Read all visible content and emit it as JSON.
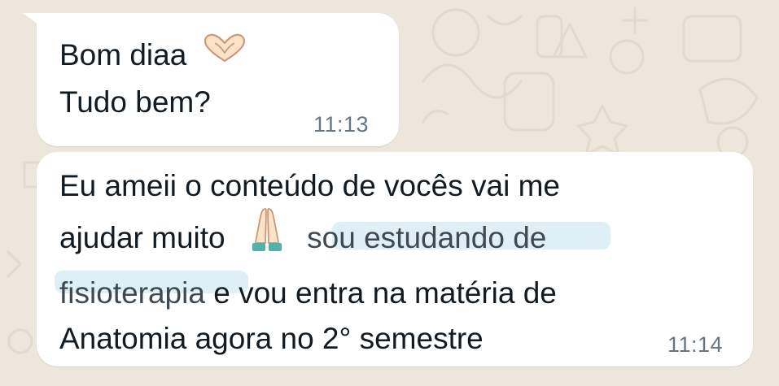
{
  "messages": [
    {
      "lines": [
        "Bom diaa",
        "Tudo bem?"
      ],
      "emoji": "heart-hands",
      "time": "11:13"
    },
    {
      "line1": "Eu ameii o conteúdo de vocês vai me",
      "line2_a": "ajudar muito",
      "line2_link": "sou estudando de",
      "line3_link": "fisioterapia",
      "line3_b": " e vou entra na matéria de",
      "line4": "Anatomia agora no 2° semestre",
      "emoji": "folded-hands",
      "time": "11:14"
    }
  ],
  "colors": {
    "wallpaper": "#ede6dd",
    "bubble": "#ffffff",
    "text": "#111b21",
    "timestamp": "#667781",
    "highlight": "#dcedf5"
  }
}
